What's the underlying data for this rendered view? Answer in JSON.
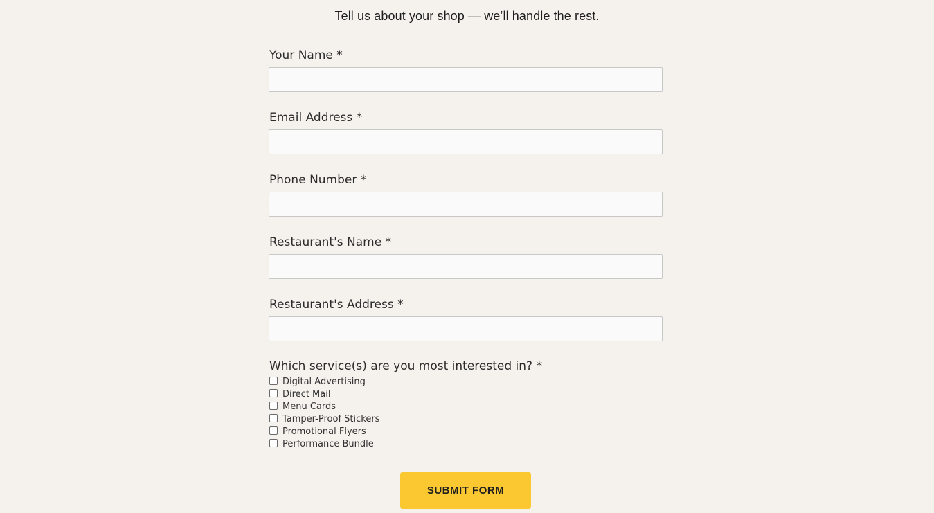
{
  "header": {
    "tagline": "Tell us about your shop — we’ll handle the rest."
  },
  "form": {
    "fields": [
      {
        "label": "Your Name *",
        "value": "",
        "placeholder": ""
      },
      {
        "label": "Email Address *",
        "value": "",
        "placeholder": ""
      },
      {
        "label": "Phone Number *",
        "value": "",
        "placeholder": ""
      },
      {
        "label": "Restaurant's Name *",
        "value": "",
        "placeholder": ""
      },
      {
        "label": "Restaurant's Address *",
        "value": "",
        "placeholder": ""
      }
    ],
    "services": {
      "label": "Which service(s) are you most interested in? *",
      "options": [
        {
          "label": "Digital Advertising",
          "checked": false
        },
        {
          "label": "Direct Mail",
          "checked": false
        },
        {
          "label": "Menu Cards",
          "checked": false
        },
        {
          "label": "Tamper-Proof Stickers",
          "checked": false
        },
        {
          "label": "Promotional Flyers",
          "checked": false
        },
        {
          "label": "Performance Bundle",
          "checked": false
        }
      ]
    },
    "submit_label": "SUBMIT FORM"
  },
  "colors": {
    "background": "#f5f2ed",
    "input_background": "#fafafa",
    "input_border": "#c8c8c8",
    "accent": "#fcc832"
  }
}
